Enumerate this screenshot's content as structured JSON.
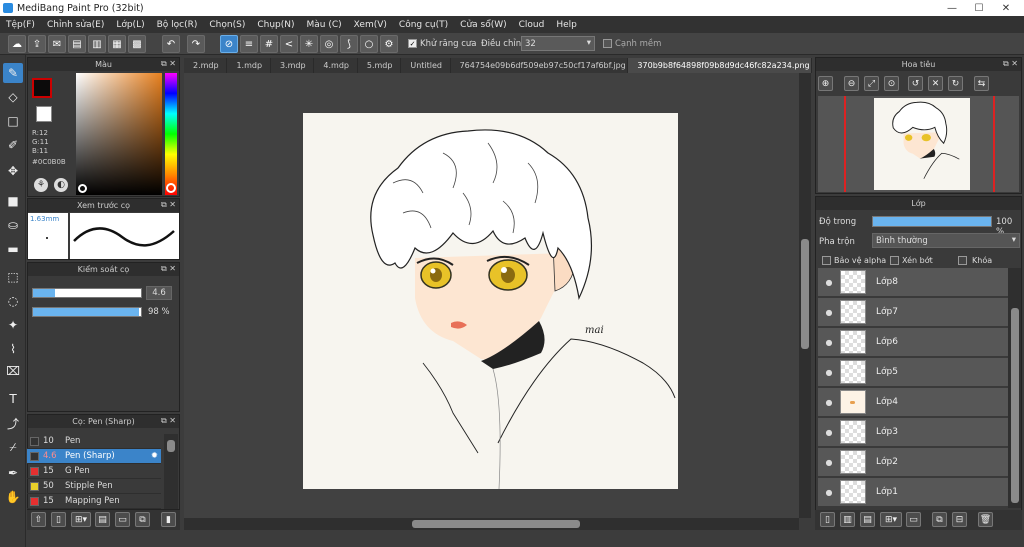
{
  "window": {
    "title": "MediBang Paint Pro (32bit)",
    "minimize": "—",
    "maximize": "☐",
    "close": "✕"
  },
  "menu": [
    "Tệp(F)",
    "Chỉnh sửa(E)",
    "Lớp(L)",
    "Bộ lọc(R)",
    "Chọn(S)",
    "Chụp(N)",
    "Màu (C)",
    "Xem(V)",
    "Công cụ(T)",
    "Cửa sổ(W)",
    "Cloud",
    "Help"
  ],
  "toolbar": {
    "antialias_label": "Khử răng cưa",
    "adjust_label": "Điều chỉnh",
    "adjust_value": "32",
    "edge_label": "Cạnh mềm"
  },
  "color_panel": {
    "title": "Màu",
    "r": "R:12",
    "g": "G:11",
    "b": "B:11",
    "hex": "#0C0B0B",
    "fg_color": "#0c0b0b",
    "accent": "#e8801e"
  },
  "brush_preview": {
    "title": "Xem trước cọ",
    "size": "1.63mm"
  },
  "brush_control": {
    "title": "Kiểm soát cọ",
    "size_value": "4.6",
    "opacity_value": "98 %",
    "size_fraction": 0.2,
    "opacity_fraction": 0.98
  },
  "brush_list": {
    "title": "Cọ: Pen (Sharp)",
    "items": [
      {
        "size": "10",
        "name": "Pen",
        "color": "#333333"
      },
      {
        "size": "4.6",
        "name": "Pen (Sharp)",
        "color": "#333333",
        "selected": true
      },
      {
        "size": "15",
        "name": "G Pen",
        "color": "#e53030"
      },
      {
        "size": "50",
        "name": "Stipple Pen",
        "color": "#e8d02a"
      },
      {
        "size": "15",
        "name": "Mapping Pen",
        "color": "#e53030"
      }
    ]
  },
  "tabs": [
    "2.mdp",
    "1.mdp",
    "3.mdp",
    "4.mdp",
    "5.mdp",
    "Untitled",
    "764754e09b6df509eb97c50cf17af6bf.jpg",
    "370b9b8f64898f09b8d9dc46fc82a234.png"
  ],
  "canvas": {
    "signature": "mai"
  },
  "navigator": {
    "title": "Hoa tiêu"
  },
  "layers": {
    "title": "Lớp",
    "opacity_label": "Độ trong",
    "opacity_value": "100 %",
    "blend_label": "Pha trộn",
    "blend_value": "Bình thường",
    "protect_alpha": "Bảo vệ alpha",
    "clipping": "Xén bớt",
    "lock": "Khóa",
    "items": [
      "Lớp8",
      "Lớp7",
      "Lớp6",
      "Lớp5",
      "Lớp4",
      "Lớp3",
      "Lớp2",
      "Lớp1"
    ]
  }
}
